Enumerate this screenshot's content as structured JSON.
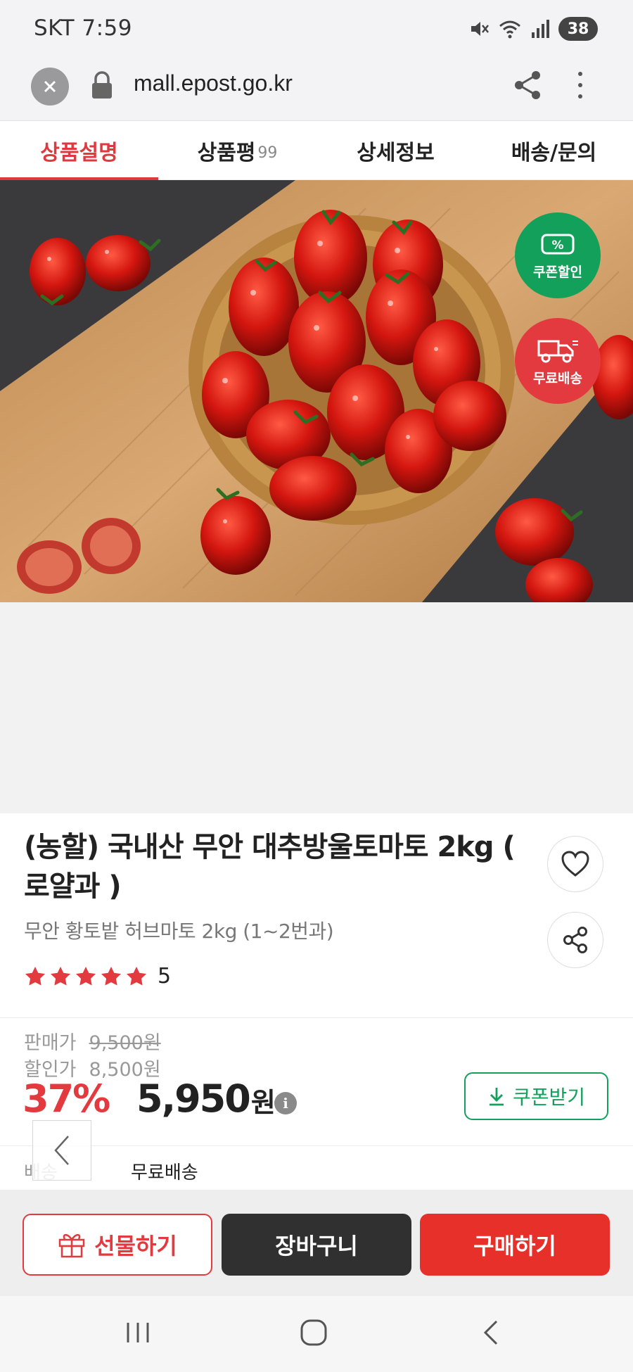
{
  "status_bar": {
    "carrier_time": "SKT 7:59",
    "battery": "38"
  },
  "browser": {
    "url": "mall.epost.go.kr"
  },
  "tabs": [
    {
      "label": "상품설명",
      "count": ""
    },
    {
      "label": "상품평",
      "count": "99"
    },
    {
      "label": "상세정보",
      "count": ""
    },
    {
      "label": "배송/문의",
      "count": ""
    }
  ],
  "badges": {
    "coupon": "쿠폰할인",
    "shipping": "무료배송"
  },
  "product": {
    "title": "(농할) 국내산 무안 대추방울토마토 2kg ( 로얄과 )",
    "subtitle": "무안 황토밭 허브마토 2kg (1~2번과)",
    "rating": 5,
    "rating_text": "5",
    "sale_price_label": "판매가",
    "sale_price": "9,500원",
    "discount_price_label": "할인가",
    "discount_price": "8,500원",
    "discount_rate": "37%",
    "final_price": "5,950",
    "final_price_unit": "원",
    "coupon_button": "쿠폰받기",
    "shipping_label": "배송",
    "shipping_value": "무료배송"
  },
  "actions": {
    "gift": "선물하기",
    "cart": "장바구니",
    "buy": "구매하기"
  },
  "colors": {
    "accent_red": "#e23a3f",
    "accent_green": "#13a05a",
    "cart_dark": "#303030"
  }
}
